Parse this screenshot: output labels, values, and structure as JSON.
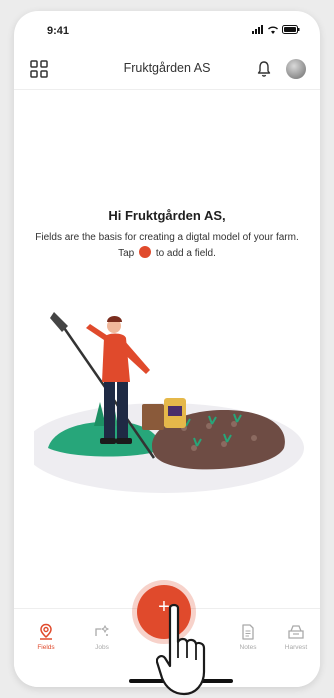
{
  "status_bar": {
    "time": "9:41"
  },
  "header": {
    "title": "Fruktgården AS"
  },
  "main": {
    "greeting": "Hi Fruktgården AS,",
    "description_before": "Fields are the basis for creating a digtal model of your farm. Tap",
    "description_after": "to add a field."
  },
  "tab_bar": {
    "items": [
      {
        "label": "Fields",
        "icon": "location-pin-icon",
        "active": true
      },
      {
        "label": "Jobs",
        "icon": "sparkle-icon",
        "active": false
      },
      {
        "label": "Notes",
        "icon": "document-icon",
        "active": false
      },
      {
        "label": "Harvest",
        "icon": "crate-icon",
        "active": false
      }
    ]
  },
  "fab": {
    "label": "+"
  },
  "colors": {
    "accent": "#e04a2c",
    "text": "#1f1f1f",
    "tab_inactive": "#a9a9a9"
  }
}
